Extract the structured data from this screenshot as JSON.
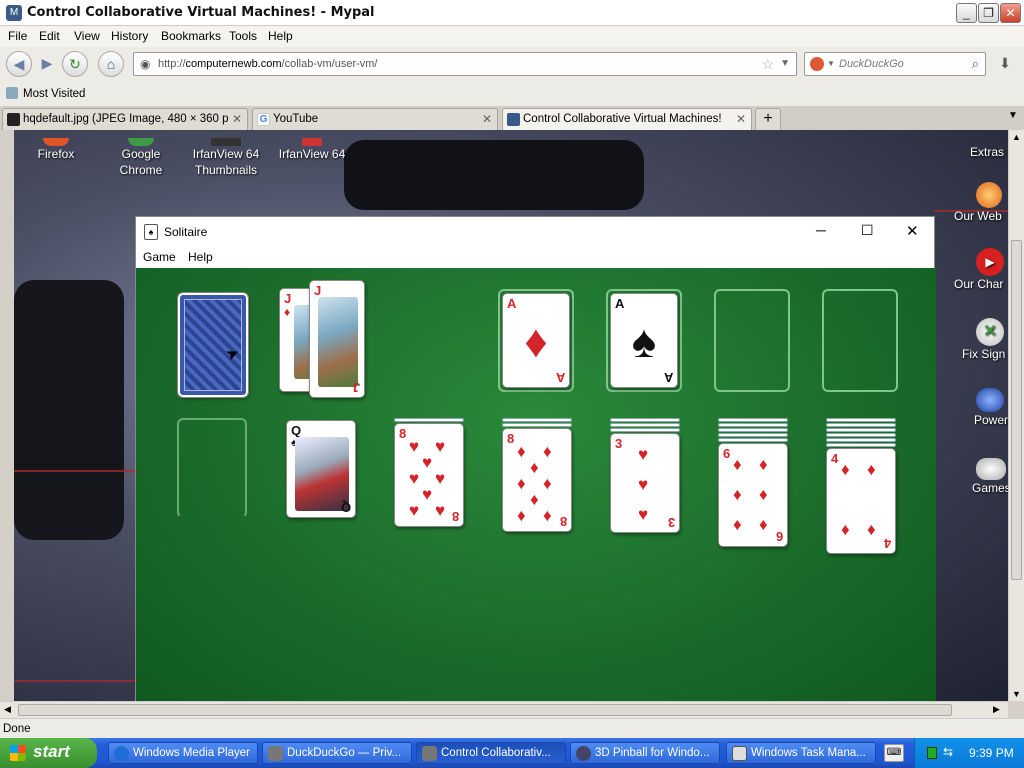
{
  "window": {
    "title": "Control Collaborative Virtual Machines! - Mypal"
  },
  "menu": [
    "File",
    "Edit",
    "View",
    "History",
    "Bookmarks",
    "Tools",
    "Help"
  ],
  "url": {
    "prefix": "http://",
    "domain": "computernewb.com",
    "path": "/collab-vm/user-vm/"
  },
  "search": {
    "placeholder": "DuckDuckGo"
  },
  "bookmarks": {
    "most_visited": "Most Visited"
  },
  "tabs": [
    {
      "label": "hqdefault.jpg (JPEG Image, 480 × 360 pi...",
      "active": false
    },
    {
      "label": "YouTube",
      "active": false
    },
    {
      "label": "Control Collaborative Virtual Machines!",
      "active": true
    }
  ],
  "desktop_icons_left": [
    {
      "label": "Firefox",
      "icon": "firefox-icon"
    },
    {
      "label": "Google Chrome",
      "icon": "chrome-icon"
    },
    {
      "label": "IrfanView 64 Thumbnails",
      "icon": "irfanview-icon"
    },
    {
      "label": "IrfanView 64",
      "icon": "irfanview-icon"
    }
  ],
  "desktop_icons_right": [
    {
      "label": "Extras",
      "icon": "extras-icon"
    },
    {
      "label": "Our Web",
      "icon": "web-icon"
    },
    {
      "label": "Our Char",
      "icon": "youtube-icon"
    },
    {
      "label": "Fix Sign",
      "icon": "xbox-icon"
    },
    {
      "label": "Power",
      "icon": "power-icon"
    },
    {
      "label": "Games",
      "icon": "gamepad-icon"
    }
  ],
  "solitaire": {
    "title": "Solitaire",
    "menu": [
      "Game",
      "Help"
    ],
    "stock": {
      "face": "back"
    },
    "waste": [
      {
        "rank": "J",
        "suit": "♦"
      },
      {
        "rank": "J",
        "suit": "♦"
      }
    ],
    "foundations": [
      {
        "rank": "A",
        "suit": "♦",
        "color": "red"
      },
      {
        "rank": "A",
        "suit": "♠",
        "color": "black"
      },
      {
        "empty": true
      },
      {
        "empty": true
      }
    ],
    "tableau": [
      {
        "empty": true,
        "hidden": 0
      },
      {
        "rank": "Q",
        "suit": "♠",
        "color": "black",
        "hidden": 0
      },
      {
        "rank": "8",
        "suit": "♥",
        "color": "red",
        "hidden": 1
      },
      {
        "rank": "8",
        "suit": "♦",
        "color": "red",
        "hidden": 2
      },
      {
        "rank": "3",
        "suit": "♥",
        "color": "red",
        "hidden": 3
      },
      {
        "rank": "6",
        "suit": "♦",
        "color": "red",
        "hidden": 5
      },
      {
        "rank": "4",
        "suit": "♦",
        "color": "red",
        "hidden": 6
      }
    ]
  },
  "status": {
    "text": "Done"
  },
  "taskbar": {
    "start": "start",
    "tasks": [
      {
        "label": "Windows Media Player",
        "active": false
      },
      {
        "label": "DuckDuckGo — Priv...",
        "active": false
      },
      {
        "label": "Control Collaborativ...",
        "active": true
      },
      {
        "label": "3D Pinball for Windo...",
        "active": false
      },
      {
        "label": "Windows Task Mana...",
        "active": false
      }
    ],
    "clock": "9:39 PM"
  }
}
